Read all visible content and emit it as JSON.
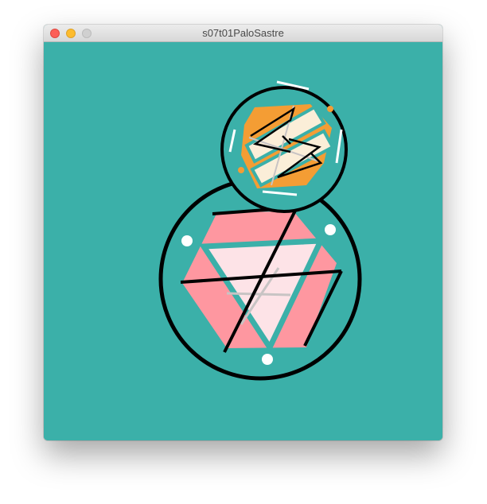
{
  "window": {
    "title": "s07t01PaloSastre"
  },
  "colors": {
    "background": "#3bb0a9",
    "stroke": "#000000",
    "orange": "#f49d34",
    "pink": "#fe97a0",
    "light_pink": "#fde3e7",
    "cream": "#fbeed8",
    "white": "#ffffff",
    "grey": "#c8c4c4"
  }
}
